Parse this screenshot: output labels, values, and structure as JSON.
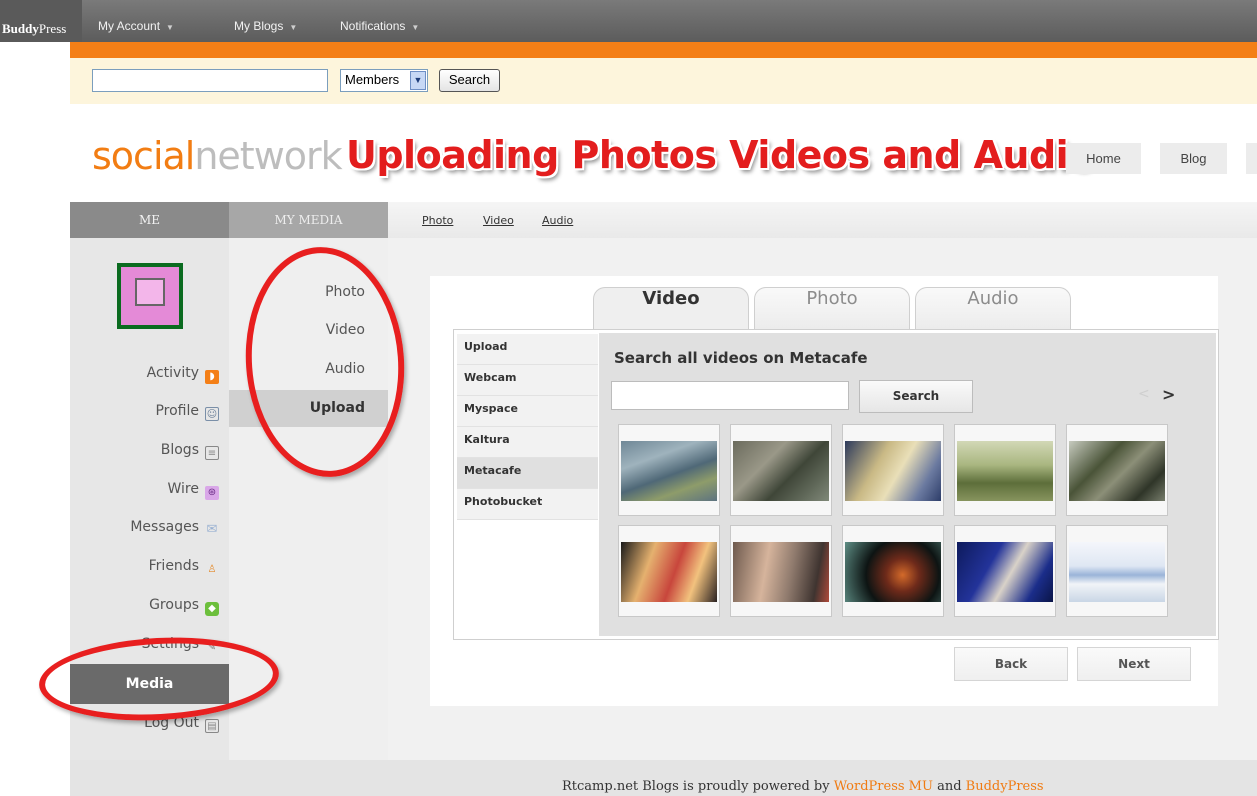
{
  "adminbar": {
    "logo_bold": "Buddy",
    "logo_rest": "Press",
    "items": [
      {
        "label": "My Account"
      },
      {
        "label": "My Blogs"
      },
      {
        "label": "Notifications"
      }
    ]
  },
  "search": {
    "input_value": "",
    "select_value": "Members",
    "button_label": "Search"
  },
  "header": {
    "title_part1": "social",
    "title_part2": "network",
    "overlay_caption": "Uploading Photos Videos and Audio",
    "nav": [
      {
        "label": "Home"
      },
      {
        "label": "Blog"
      }
    ]
  },
  "tabs": {
    "me": "ME",
    "my_media": "MY MEDIA",
    "sub": [
      {
        "label": "Photo"
      },
      {
        "label": "Video"
      },
      {
        "label": "Audio"
      }
    ]
  },
  "sidebar": {
    "items": [
      {
        "label": "Activity",
        "icon": "rss-icon"
      },
      {
        "label": "Profile",
        "icon": "profile-icon"
      },
      {
        "label": "Blogs",
        "icon": "blogs-icon"
      },
      {
        "label": "Wire",
        "icon": "wire-icon"
      },
      {
        "label": "Messages",
        "icon": "envelope-icon"
      },
      {
        "label": "Friends",
        "icon": "person-icon"
      },
      {
        "label": "Groups",
        "icon": "cube-icon"
      },
      {
        "label": "Settings",
        "icon": "wrench-icon"
      },
      {
        "label": "Media",
        "icon": ""
      },
      {
        "label": "Log Out",
        "icon": "logout-icon"
      }
    ],
    "active": "Media"
  },
  "media_menu": {
    "items": [
      {
        "label": "Photo"
      },
      {
        "label": "Video"
      },
      {
        "label": "Audio"
      },
      {
        "label": "Upload"
      }
    ],
    "active": "Upload"
  },
  "uploader": {
    "tabs": [
      {
        "label": "Video"
      },
      {
        "label": "Photo"
      },
      {
        "label": "Audio"
      }
    ],
    "active_tab": "Video",
    "sources": [
      {
        "label": "Upload"
      },
      {
        "label": "Webcam"
      },
      {
        "label": "Myspace"
      },
      {
        "label": "Kaltura"
      },
      {
        "label": "Metacafe"
      },
      {
        "label": "Photobucket"
      }
    ],
    "active_source": "Metacafe",
    "search_title": "Search all videos on Metacafe",
    "search_value": "",
    "search_button": "Search",
    "prev_glyph": "<",
    "next_glyph": ">",
    "back_button": "Back",
    "next_button": "Next"
  },
  "footer": {
    "prefix": "Rtcamp.net Blogs is proudly powered by ",
    "link1": "WordPress MU",
    "middle": " and ",
    "link2": "BuddyPress"
  },
  "colors": {
    "accent": "#f47f17",
    "annotation": "#e31d1d"
  }
}
